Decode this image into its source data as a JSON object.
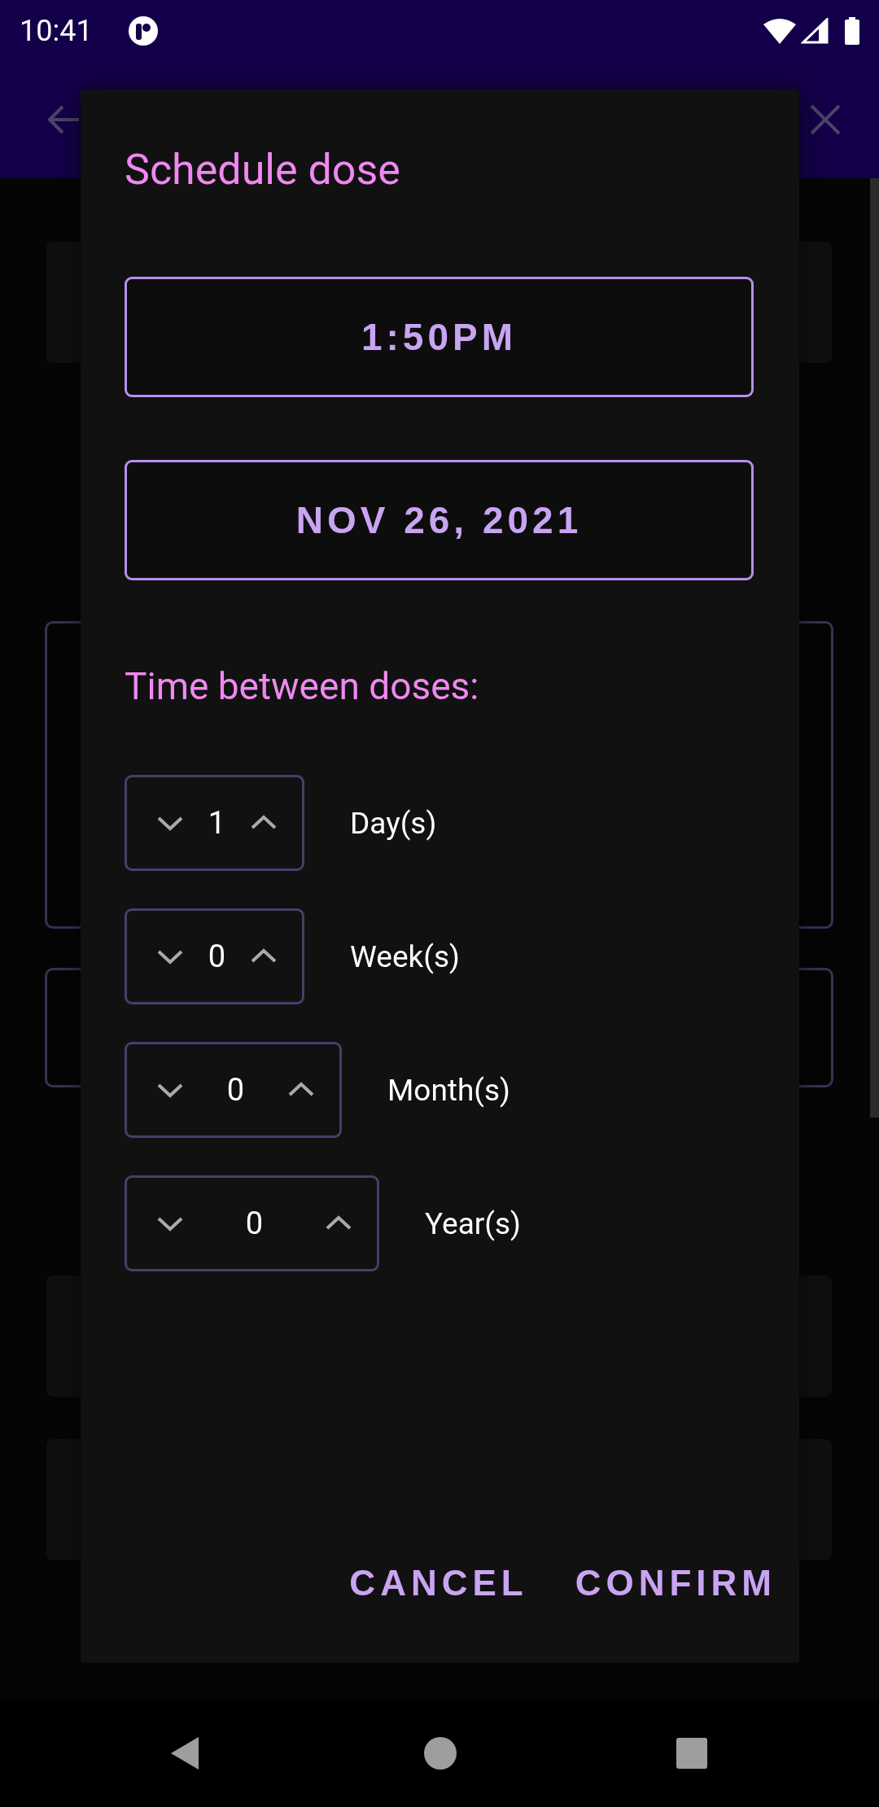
{
  "status_bar": {
    "time": "10:41"
  },
  "dialog": {
    "title": "Schedule dose",
    "time_button": "1:50PM",
    "date_button": "NOV 26, 2021",
    "interval_label": "Time between doses:",
    "intervals": [
      {
        "value": "1",
        "unit": "Day(s)"
      },
      {
        "value": "0",
        "unit": "Week(s)"
      },
      {
        "value": "0",
        "unit": "Month(s)"
      },
      {
        "value": "0",
        "unit": "Year(s)"
      }
    ],
    "buttons": [
      "CANCEL",
      "CONFIRM"
    ]
  }
}
